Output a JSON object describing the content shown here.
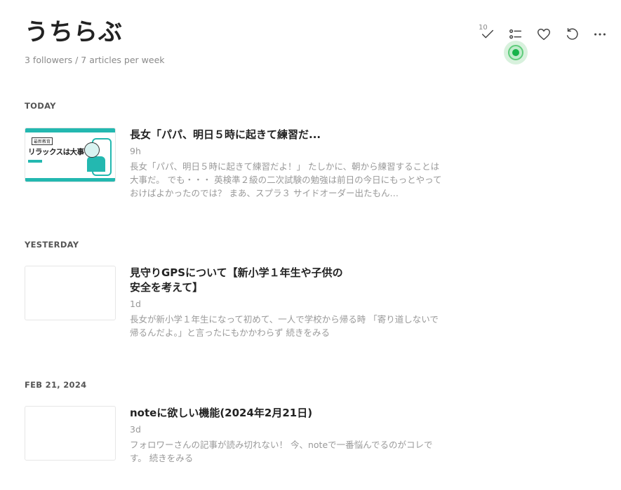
{
  "header": {
    "title": "うちらぶ",
    "subtitle": "3 followers / 7 articles per week"
  },
  "actions": {
    "read_count": "10"
  },
  "sections": [
    {
      "label": "TODAY",
      "article": {
        "title": "長女「パパ、明日５時に起きて練習だ...",
        "time": "9h",
        "excerpt": "長女「パパ、明日５時に起きて練習だよ！」 たしかに、朝から練習することは大事だ。 でも・・・ 英検準２級の二次試験の勉強は前日の今日にもっとやっておけばよかったのでは？ まあ、スプラ３ サイドオーダー出たもん…",
        "thumbnail": {
          "badge": "最新教育",
          "text": "リラックスは大事"
        }
      }
    },
    {
      "label": "YESTERDAY",
      "article": {
        "title_line1": "見守りGPSについて【新小学１年生や子供の",
        "title_line2": "安全を考えて】",
        "time": "1d",
        "excerpt": "長女が新小学１年生になって初めて、一人で学校から帰る時 「寄り道しないで帰るんだよ。」と言ったにもかかわらず 続きをみる"
      }
    },
    {
      "label": "FEB 21, 2024",
      "article": {
        "title": "noteに欲しい機能(2024年2月21日)",
        "time": "3d",
        "excerpt": "フォロワーさんの記事が読み切れない！ 今、noteで一番悩んでるのがコレです。 続きをみる"
      }
    }
  ],
  "colors": {
    "accent_teal": "#23b8b0",
    "record_green": "#17b34a"
  }
}
